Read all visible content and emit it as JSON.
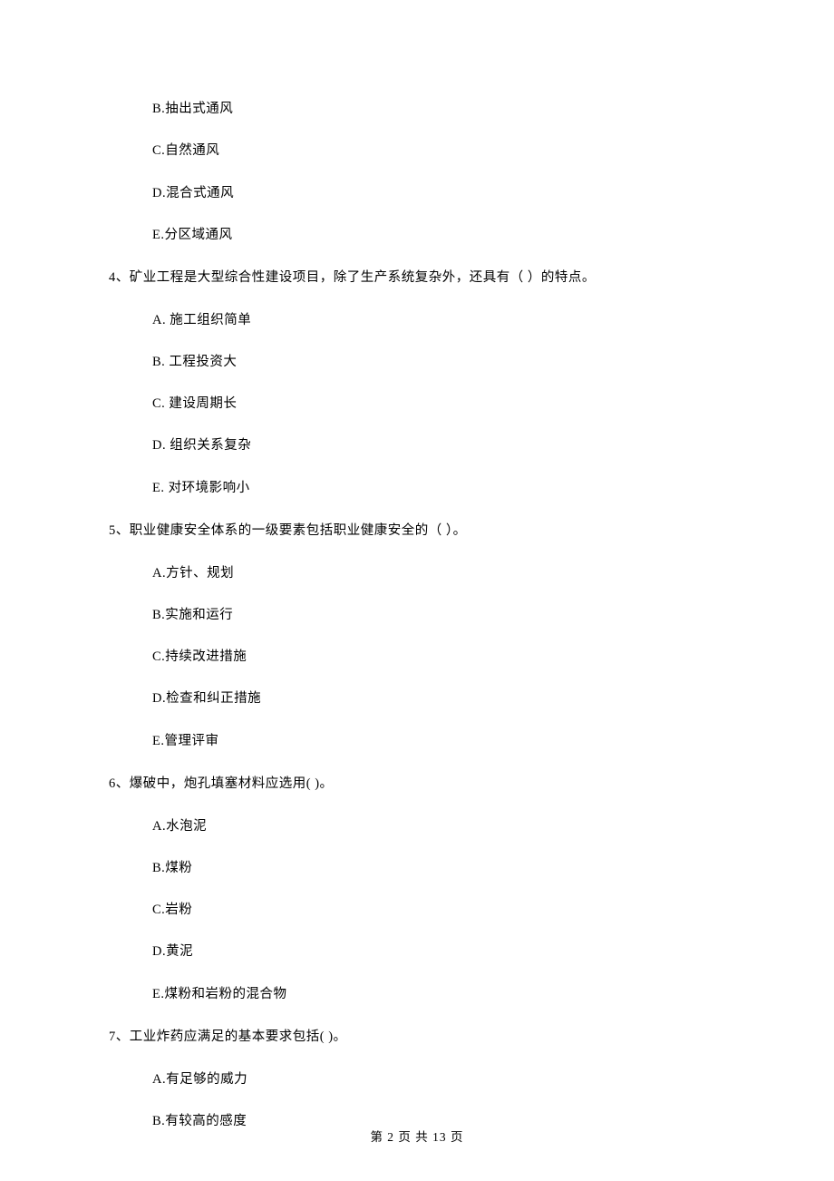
{
  "q3_partial": {
    "options": [
      "B.抽出式通风",
      "C.自然通风",
      "D.混合式通风",
      "E.分区域通风"
    ]
  },
  "q4": {
    "stem": "4、矿业工程是大型综合性建设项目，除了生产系统复杂外，还具有（    ）的特点。",
    "options": [
      "A.  施工组织简单",
      "B.  工程投资大",
      "C.  建设周期长",
      "D.  组织关系复杂",
      "E.  对环境影响小"
    ]
  },
  "q5": {
    "stem": "5、职业健康安全体系的一级要素包括职业健康安全的（      ）。",
    "options": [
      "A.方针、规划",
      "B.实施和运行",
      "C.持续改进措施",
      "D.检查和纠正措施",
      "E.管理评审"
    ]
  },
  "q6": {
    "stem": "6、爆破中，炮孔填塞材料应选用(      )。",
    "options": [
      "A.水泡泥",
      "B.煤粉",
      "C.岩粉",
      "D.黄泥",
      "E.煤粉和岩粉的混合物"
    ]
  },
  "q7": {
    "stem": "7、工业炸药应满足的基本要求包括(      )。",
    "options": [
      "A.有足够的威力",
      "B.有较高的感度"
    ]
  },
  "footer": "第 2 页 共 13 页"
}
